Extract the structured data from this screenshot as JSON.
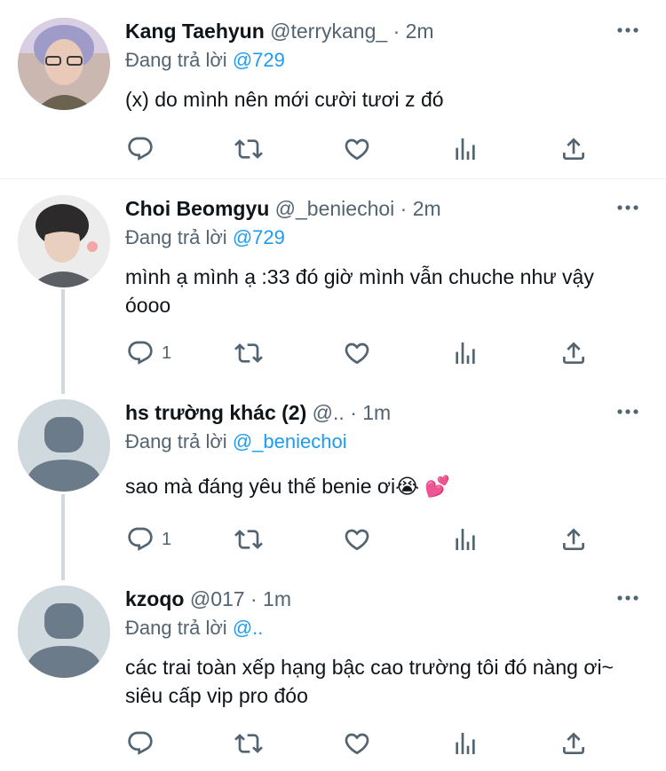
{
  "tweets": [
    {
      "name": "Kang Taehyun",
      "handle": "@terrykang_",
      "dot": "·",
      "time": "2m",
      "reply_prefix": "Đang trả lời",
      "reply_to": "@729",
      "text": "(x) do mình nên mới cười tươi z đó",
      "reply_count": "",
      "avatar": "photo-avatar"
    },
    {
      "name": "Choi Beomgyu",
      "handle": "@_beniechoi",
      "dot": "·",
      "time": "2m",
      "reply_prefix": "Đang trả lời",
      "reply_to": "@729",
      "text": "mình ạ mình ạ :33 đó giờ mình vẫn chuche như vậy óooo",
      "reply_count": "1",
      "avatar": "photo-avatar"
    },
    {
      "name": "hs trường khác (2)",
      "handle": "@..",
      "dot": "·",
      "time": "1m",
      "reply_prefix": "Đang trả lời",
      "reply_to": "@_beniechoi",
      "text": "sao mà đáng yêu thế benie ơi😭 💕",
      "reply_count": "1",
      "avatar": "default-avatar"
    },
    {
      "name": "kzoqo",
      "handle": "@017",
      "dot": "·",
      "time": "1m",
      "reply_prefix": "Đang trả lời",
      "reply_to": "@..",
      "text": "các trai toàn xếp hạng bậc cao trường tôi đó nàng ơi~ siêu cấp vip pro đóo",
      "reply_count": "",
      "avatar": "default-avatar"
    }
  ],
  "icons": [
    "more-icon",
    "reply-icon",
    "retweet-icon",
    "like-icon",
    "analytics-icon",
    "share-icon"
  ],
  "colors": {
    "accent": "#1d9bf0",
    "secondary_text": "#536471",
    "icon": "#536471",
    "thread_line": "#cfd9de"
  }
}
